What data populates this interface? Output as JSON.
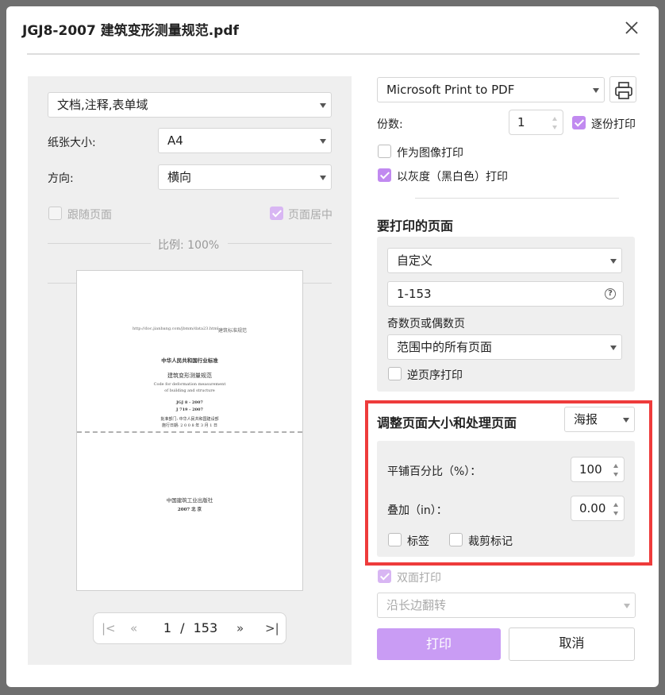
{
  "window": {
    "title": "JGJ8-2007 建筑变形测量规范.pdf"
  },
  "left": {
    "content_select": "文档,注释,表单域",
    "paper_size_label": "纸张大小:",
    "paper_size_value": "A4",
    "orientation_label": "方向:",
    "orientation_value": "横向",
    "follow_page_label": "跟随页面",
    "center_page_label": "页面居中",
    "scale_label": "比例: 100%",
    "preview": {
      "url_line": "http://doc.jianbang.com/jbmm/data23.html",
      "header_right": "建筑标准规范",
      "line1": "中华人民共和国行业标准",
      "line2": "建筑变形测量规范",
      "line3": "Code for deformation measurement",
      "line4": "of building and structure",
      "line5": "JGJ 8 - 2007",
      "line6": "J 719 - 2007",
      "line7": "批准部门: 中华人民共和国建设部",
      "line8": "施行日期: 2 0 0 8 年 3 月 1 日",
      "publisher": "中国建筑工业出版社",
      "year": "2007  北  京"
    },
    "pager": {
      "current": "1",
      "separator": "/",
      "total": "153"
    }
  },
  "right": {
    "printer": "Microsoft Print to PDF",
    "copies_label": "份数:",
    "copies_value": "1",
    "collate_label": "逐份打印",
    "print_as_image_label": "作为图像打印",
    "grayscale_label": "以灰度（黑白色）打印",
    "pages_title": "要打印的页面",
    "pages_mode": "自定义",
    "pages_range": "1-153",
    "odd_even_label": "奇数页或偶数页",
    "odd_even_value": "范围中的所有页面",
    "reverse_label": "逆页序打印",
    "resize_title": "调整页面大小和处理页面",
    "resize_mode": "海报",
    "tile_label": "平铺百分比（%）：",
    "tile_value": "100",
    "overlap_label": "叠加（in）：",
    "overlap_value": "0.00",
    "labels_label": "标签",
    "crop_marks_label": "裁剪标记",
    "duplex_label": "双面打印",
    "flip_value": "沿长边翻转",
    "print_button": "打印",
    "cancel_button": "取消"
  },
  "colors": {
    "accent": "#c18af0",
    "highlight": "#ee3b3b",
    "panel": "#efefef"
  }
}
